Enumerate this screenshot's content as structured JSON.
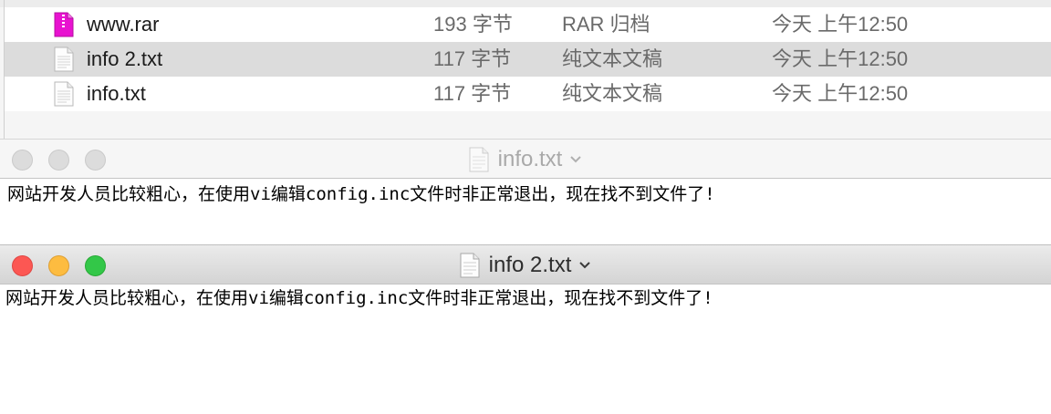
{
  "finder": {
    "files": [
      {
        "name": "www.rar",
        "size": "193 字节",
        "kind": "RAR 归档",
        "date": "今天 上午12:50",
        "icon": "rar-archive-icon"
      },
      {
        "name": "info 2.txt",
        "size": "117 字节",
        "kind": "纯文本文稿",
        "date": "今天 上午12:50",
        "icon": "text-document-icon"
      },
      {
        "name": "info.txt",
        "size": "117 字节",
        "kind": "纯文本文稿",
        "date": "今天 上午12:50",
        "icon": "text-document-icon"
      }
    ],
    "selected_index": 1
  },
  "window_back": {
    "title": "info.txt",
    "content": "网站开发人员比较粗心，在使用vi编辑config.inc文件时非正常退出，现在找不到文件了!",
    "active": false
  },
  "window_front": {
    "title": "info 2.txt",
    "content": "网站开发人员比较粗心，在使用vi编辑config.inc文件时非正常退出，现在找不到文件了!",
    "active": true
  },
  "colors": {
    "close": "#fc5753",
    "minimize": "#fdbc40",
    "zoom": "#33c748",
    "selection": "#dcdcdc",
    "archive_icon": "#e812d0"
  }
}
